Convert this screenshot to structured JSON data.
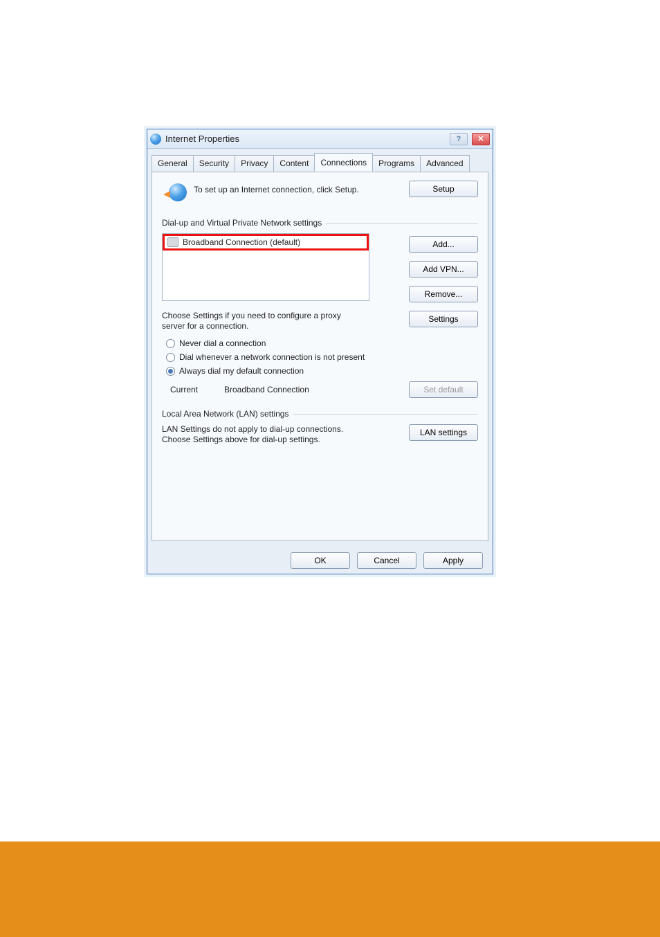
{
  "window": {
    "title": "Internet Properties"
  },
  "tabs": {
    "items": [
      {
        "label": "General"
      },
      {
        "label": "Security"
      },
      {
        "label": "Privacy"
      },
      {
        "label": "Content"
      },
      {
        "label": "Connections"
      },
      {
        "label": "Programs"
      },
      {
        "label": "Advanced"
      }
    ],
    "activeIndex": 4
  },
  "setup": {
    "text": "To set up an Internet connection, click Setup.",
    "button": "Setup"
  },
  "dialup": {
    "sectionLabel": "Dial-up and Virtual Private Network settings",
    "listItem": "Broadband Connection (default)",
    "addButton": "Add...",
    "addVpnButton": "Add VPN...",
    "removeButton": "Remove..."
  },
  "proxy": {
    "text": "Choose Settings if you need to configure a proxy server for a connection.",
    "button": "Settings"
  },
  "radios": {
    "never": "Never dial a connection",
    "whenever": "Dial whenever a network connection is not present",
    "always": "Always dial my default connection",
    "selected": "always"
  },
  "current": {
    "label": "Current",
    "value": "Broadband Connection",
    "setDefaultButton": "Set default"
  },
  "lan": {
    "sectionLabel": "Local Area Network (LAN) settings",
    "text": "LAN Settings do not apply to dial-up connections. Choose Settings above for dial-up settings.",
    "button": "LAN settings"
  },
  "dialogButtons": {
    "ok": "OK",
    "cancel": "Cancel",
    "apply": "Apply"
  }
}
